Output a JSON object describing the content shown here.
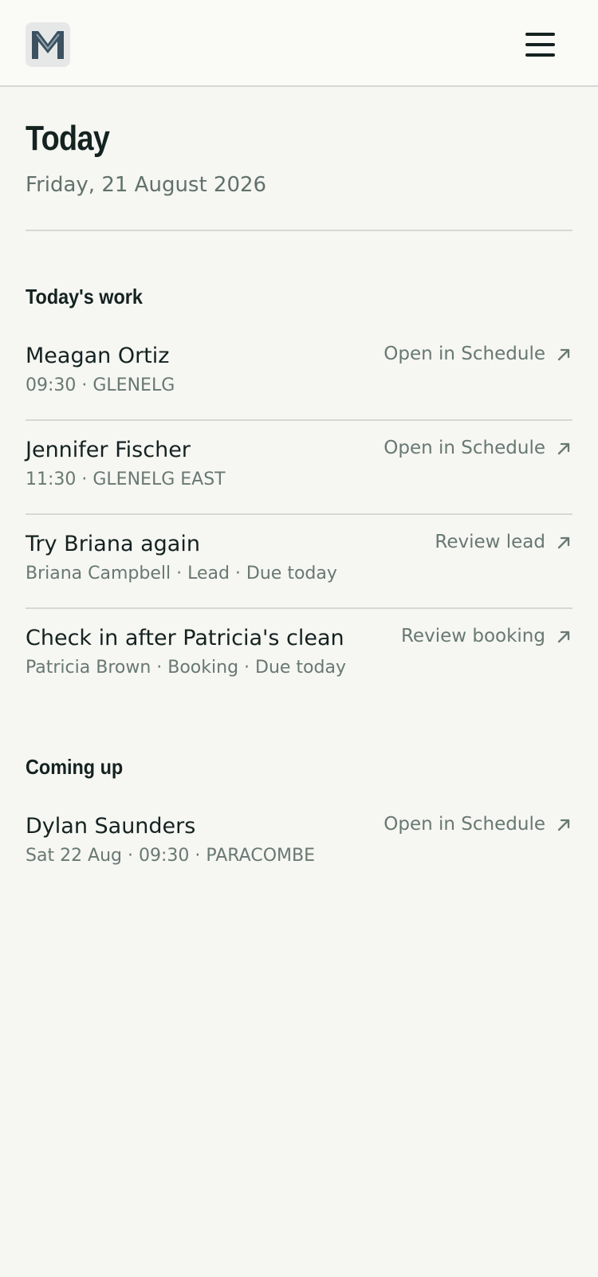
{
  "header": {
    "logo_letter": "M",
    "menu_icon": "hamburger-menu-icon"
  },
  "page": {
    "title": "Today",
    "date": "Friday, 21 August 2026"
  },
  "sections": {
    "today": {
      "heading": "Today's work",
      "items": [
        {
          "title": "Meagan Ortiz",
          "meta": "09:30 · GLENELG",
          "action": "Open in Schedule"
        },
        {
          "title": "Jennifer Fischer",
          "meta": "11:30 · GLENELG EAST",
          "action": "Open in Schedule"
        },
        {
          "title": "Try Briana again",
          "meta": "Briana Campbell · Lead · Due today",
          "action": "Review lead"
        },
        {
          "title": "Check in after Patricia's clean",
          "meta": "Patricia Brown · Booking · Due today",
          "action": "Review booking"
        }
      ]
    },
    "upcoming": {
      "heading": "Coming up",
      "items": [
        {
          "title": "Dylan Saunders",
          "meta": "Sat 22 Aug · 09:30 · PARACOMBE",
          "action": "Open in Schedule"
        }
      ]
    }
  },
  "icons": {
    "action": "arrow-up-right-icon"
  },
  "colors": {
    "background": "#f6f6f3",
    "header_background": "#fafaf7",
    "text_primary": "#142220",
    "text_secondary": "#687873",
    "divider": "#d6d8d4",
    "logo_tile": "#e6e8e8",
    "logo_mark": "#3d5160"
  }
}
